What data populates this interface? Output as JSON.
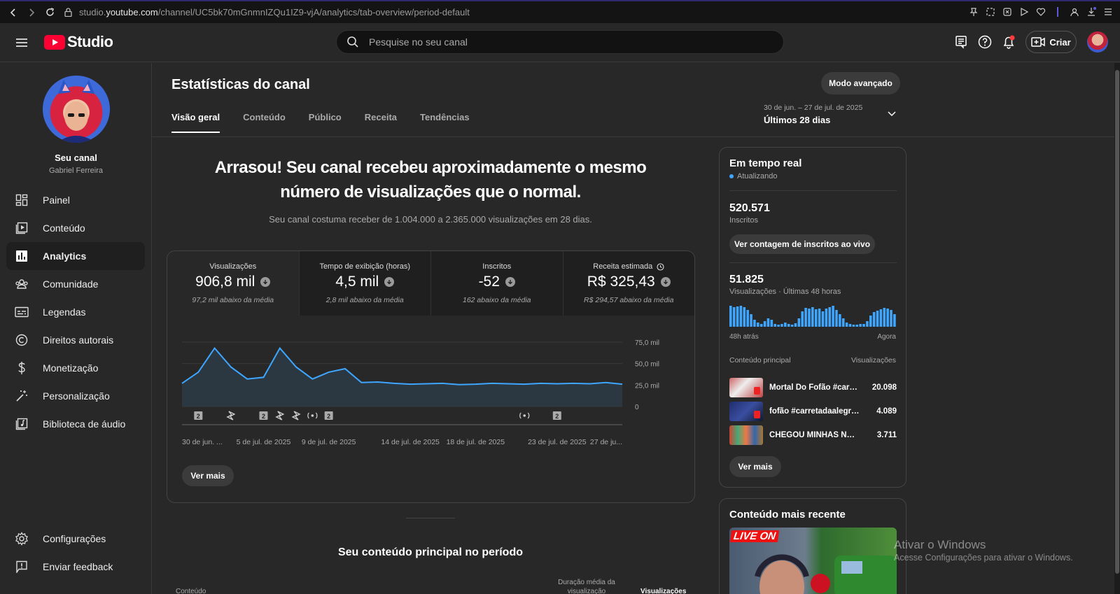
{
  "browser": {
    "url_prefix": "studio.",
    "url_host": "youtube.com",
    "url_path": "/channel/UC5bk70mGnmnIZQu1IZ9-vjA/analytics/tab-overview/period-default"
  },
  "header": {
    "logo_text": "Studio",
    "search_placeholder": "Pesquise no seu canal",
    "create_label": "Criar"
  },
  "sidebar": {
    "channel_label": "Seu canal",
    "channel_name": "Gabriel Ferreira",
    "items": [
      {
        "label": "Painel",
        "icon": "dashboard-icon"
      },
      {
        "label": "Conteúdo",
        "icon": "content-icon"
      },
      {
        "label": "Analytics",
        "icon": "analytics-icon",
        "active": true
      },
      {
        "label": "Comunidade",
        "icon": "community-icon"
      },
      {
        "label": "Legendas",
        "icon": "subtitles-icon"
      },
      {
        "label": "Direitos autorais",
        "icon": "copyright-icon"
      },
      {
        "label": "Monetização",
        "icon": "dollar-icon"
      },
      {
        "label": "Personalização",
        "icon": "magic-wand-icon"
      },
      {
        "label": "Biblioteca de áudio",
        "icon": "audio-library-icon"
      }
    ],
    "bottom_items": [
      {
        "label": "Configurações",
        "icon": "gear-icon"
      },
      {
        "label": "Enviar feedback",
        "icon": "feedback-icon"
      }
    ]
  },
  "main": {
    "title": "Estatísticas do canal",
    "advanced_button": "Modo avançado",
    "tabs": [
      "Visão geral",
      "Conteúdo",
      "Público",
      "Receita",
      "Tendências"
    ],
    "active_tab": "Visão geral",
    "period_range": "30 de jun. – 27 de jul. de 2025",
    "period_label": "Últimos 28 dias",
    "headline": "Arrasou! Seu canal recebeu aproximadamente o mesmo número de visualizações que o normal.",
    "subline": "Seu canal costuma receber de 1.004.000 a 2.365.000 visualizações em 28 dias.",
    "metrics": [
      {
        "label": "Visualizações",
        "value": "906,8 mil",
        "note": "97,2 mil abaixo da média"
      },
      {
        "label": "Tempo de exibição (horas)",
        "value": "4,5 mil",
        "note": "2,8 mil abaixo da média"
      },
      {
        "label": "Inscritos",
        "value": "-52",
        "note": "162 abaixo da média"
      },
      {
        "label": "Receita estimada",
        "value": "R$ 325,43",
        "note": "R$ 294,57 abaixo da média"
      }
    ],
    "see_more": "Ver mais",
    "top_content_title": "Seu conteúdo principal no período",
    "table_headers": {
      "content": "Conteúdo",
      "duration": "Duração média da visualização",
      "views": "Visualizações"
    }
  },
  "chart_data": {
    "type": "area",
    "x": [
      "30 de jun.",
      "1 jul",
      "2 jul",
      "3 jul",
      "4 jul",
      "5 jul",
      "6 jul",
      "7 jul",
      "8 jul",
      "9 jul",
      "10 jul",
      "11 jul",
      "12 jul",
      "13 jul",
      "14 jul",
      "15 jul",
      "16 jul",
      "17 jul",
      "18 jul",
      "19 jul",
      "20 jul",
      "21 jul",
      "22 jul",
      "23 jul",
      "24 jul",
      "25 jul",
      "26 jul",
      "27 jul"
    ],
    "values": [
      27000,
      40000,
      68000,
      46000,
      32000,
      34000,
      68000,
      46000,
      32000,
      40000,
      44000,
      28000,
      28500,
      27000,
      26000,
      26500,
      27000,
      25500,
      26000,
      27000,
      26500,
      26000,
      27000,
      26500,
      27000,
      26500,
      28000,
      26000
    ],
    "x_tick_labels": [
      "30 de jun. ...",
      "5 de jul. de 2025",
      "9 de jul. de 2025",
      "14 de jul. de 2025",
      "18 de jul. de 2025",
      "23 de jul. de 2025",
      "27 de ju..."
    ],
    "y_tick_labels": [
      "75,0 mil",
      "50,0 mil",
      "25,0 mil",
      "0"
    ],
    "ylim": [
      0,
      75000
    ],
    "markers": [
      "2",
      "shorts",
      "2",
      "shorts",
      "shorts",
      "live",
      "2",
      "live",
      "2"
    ],
    "colors": {
      "line": "#3ea6ff",
      "fill": "#2b3a45",
      "grid": "#3a3a3a"
    }
  },
  "realtime": {
    "title": "Em tempo real",
    "status": "Atualizando",
    "subscribers_value": "520.571",
    "subscribers_label": "Inscritos",
    "live_count_button": "Ver contagem de inscritos ao vivo",
    "views_value": "51.825",
    "views_label": "Visualizações · Últimas 48 horas",
    "axis_left": "48h atrás",
    "axis_right": "Agora",
    "bars": [
      30,
      28,
      29,
      30,
      28,
      24,
      18,
      10,
      6,
      4,
      8,
      12,
      10,
      4,
      3,
      4,
      6,
      4,
      3,
      5,
      12,
      22,
      27,
      26,
      28,
      25,
      26,
      22,
      26,
      28,
      30,
      24,
      18,
      12,
      6,
      4,
      3,
      3,
      4,
      4,
      8,
      16,
      21,
      23,
      25,
      27,
      26,
      24,
      18
    ],
    "top_header_left": "Conteúdo principal",
    "top_header_right": "Visualizações",
    "top_items": [
      {
        "title": "Mortal Do Fofão #carret...",
        "views": "20.098"
      },
      {
        "title": "fofão #carretadaalegria ...",
        "views": "4.089"
      },
      {
        "title": "CHEGOU MINHAS NOVA...",
        "views": "3.711"
      }
    ],
    "see_more": "Ver mais"
  },
  "recent": {
    "title": "Conteúdo mais recente",
    "badge": "LIVE ON"
  },
  "watermark": {
    "title": "Ativar o Windows",
    "subtitle": "Acesse Configurações para ativar o Windows."
  }
}
